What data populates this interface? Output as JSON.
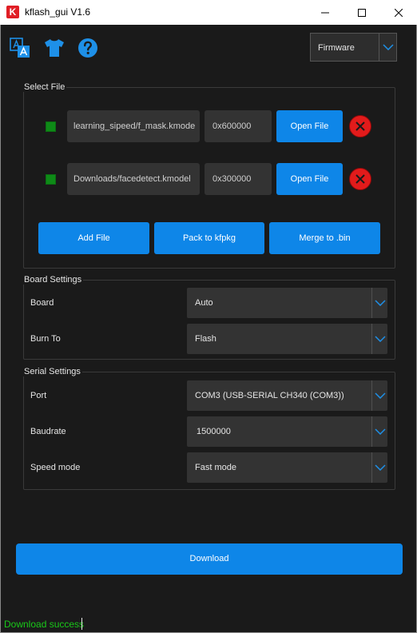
{
  "window": {
    "app_icon_letter": "K",
    "title": "kflash_gui V1.6"
  },
  "toolbar": {
    "firmware_select": "Firmware"
  },
  "select_file": {
    "title": "Select File",
    "files": [
      {
        "path": "learning_sipeed/f_mask.kmode",
        "address": "0x600000",
        "open_label": "Open File"
      },
      {
        "path": "Downloads/facedetect.kmodel",
        "address": "0x300000",
        "open_label": "Open File"
      }
    ],
    "add_file_label": "Add File",
    "pack_label": "Pack to kfpkg",
    "merge_label": "Merge to .bin"
  },
  "board_settings": {
    "title": "Board Settings",
    "board_label": "Board",
    "board_value": "Auto",
    "burn_to_label": "Burn To",
    "burn_to_value": "Flash"
  },
  "serial_settings": {
    "title": "Serial Settings",
    "port_label": "Port",
    "port_value": "COM3 (USB-SERIAL CH340 (COM3))",
    "baudrate_label": "Baudrate",
    "baudrate_value": "1500000",
    "speed_label": "Speed mode",
    "speed_value": "Fast mode"
  },
  "download_label": "Download",
  "status": "Download success",
  "colors": {
    "accent": "#0e86e8",
    "background": "#1a1a1a",
    "status_ok": "#19c919",
    "delete": "#e21b1b",
    "file_ok": "#0e8a17"
  }
}
